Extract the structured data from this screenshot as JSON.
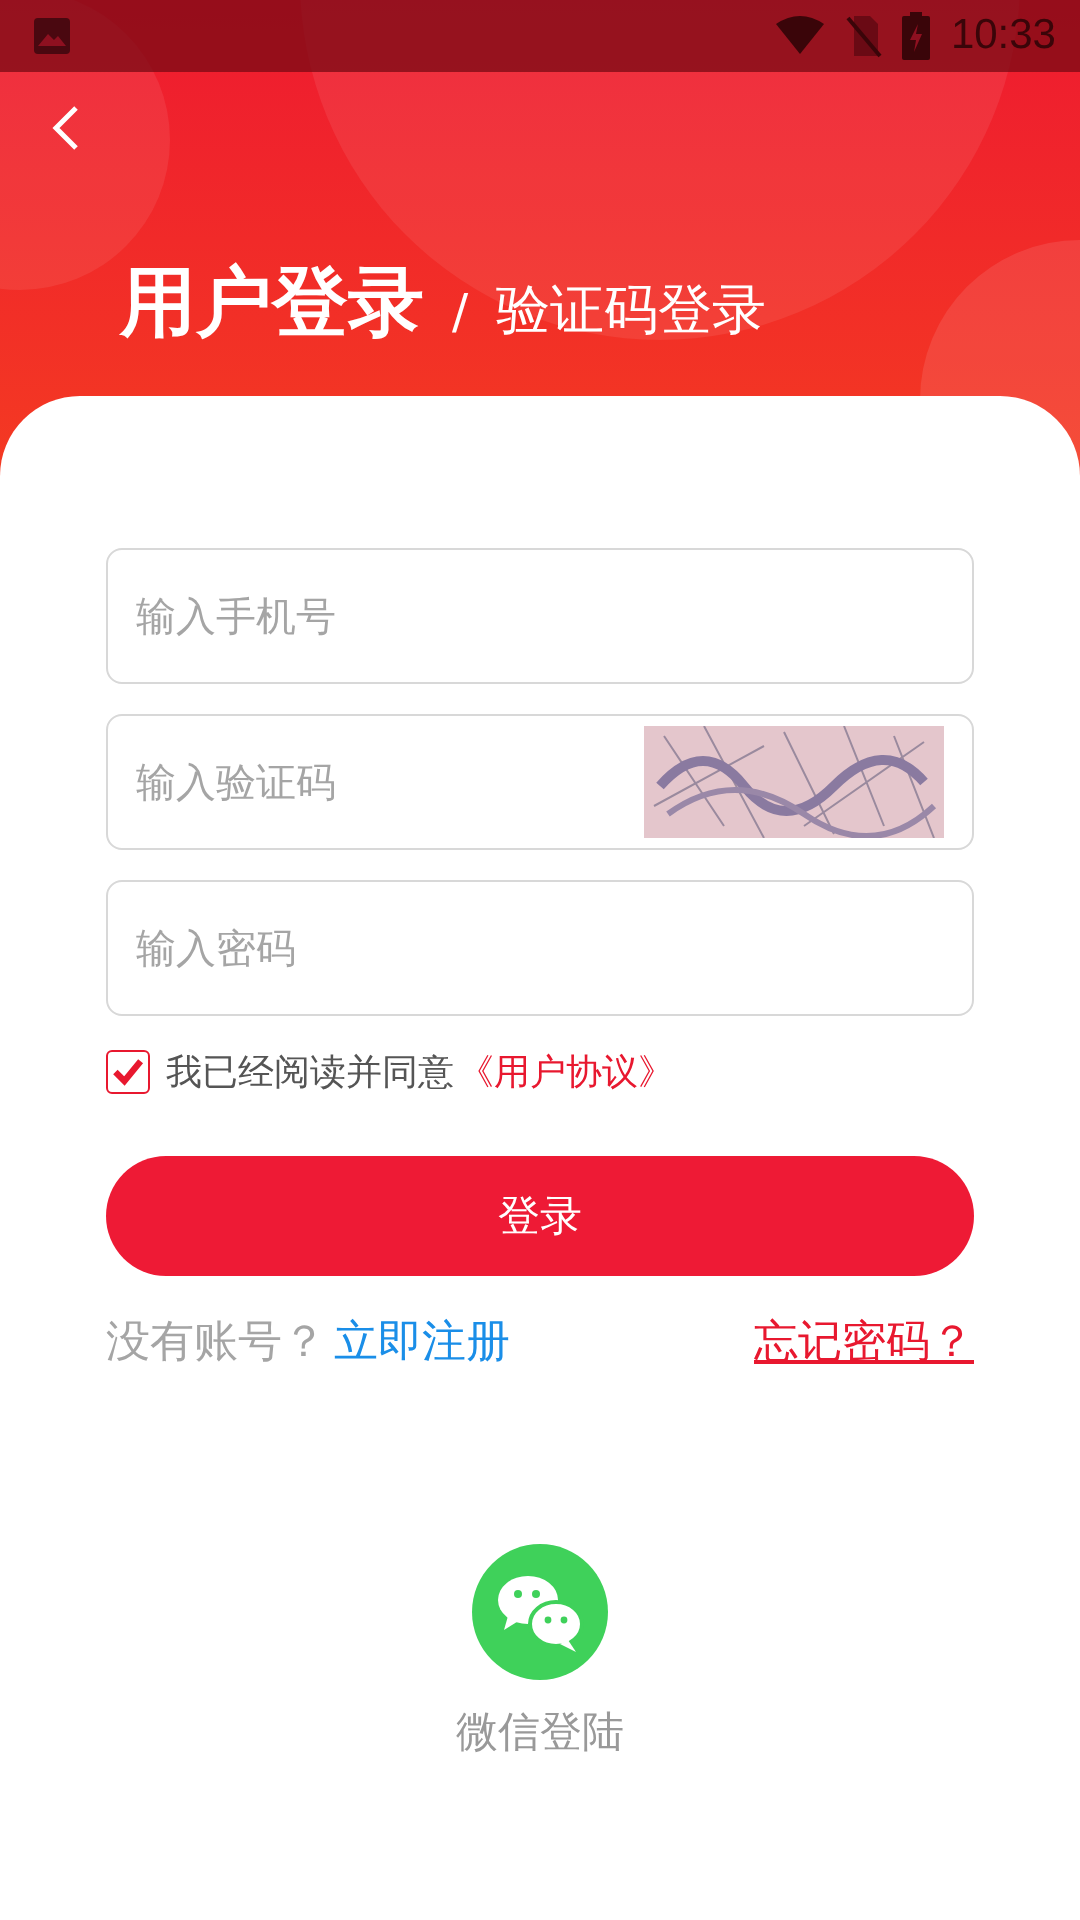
{
  "status_bar": {
    "time": "10:33"
  },
  "header": {
    "title": "用户登录",
    "separator": "/",
    "alt_mode": "验证码登录"
  },
  "fields": [
    {
      "kind": "text",
      "placeholder": "输入手机号"
    },
    {
      "kind": "captcha",
      "placeholder": "输入验证码"
    },
    {
      "kind": "password",
      "placeholder": "输入密码"
    }
  ],
  "agreement": {
    "checked": true,
    "text": "我已经阅读并同意",
    "link": "《用户协议》"
  },
  "login_button": "登录",
  "links": {
    "prompt": "没有账号？",
    "register": "立即注册",
    "forgot": "忘记密码？"
  },
  "social": [
    {
      "kind": "wechat",
      "label": "微信登陆"
    }
  ]
}
